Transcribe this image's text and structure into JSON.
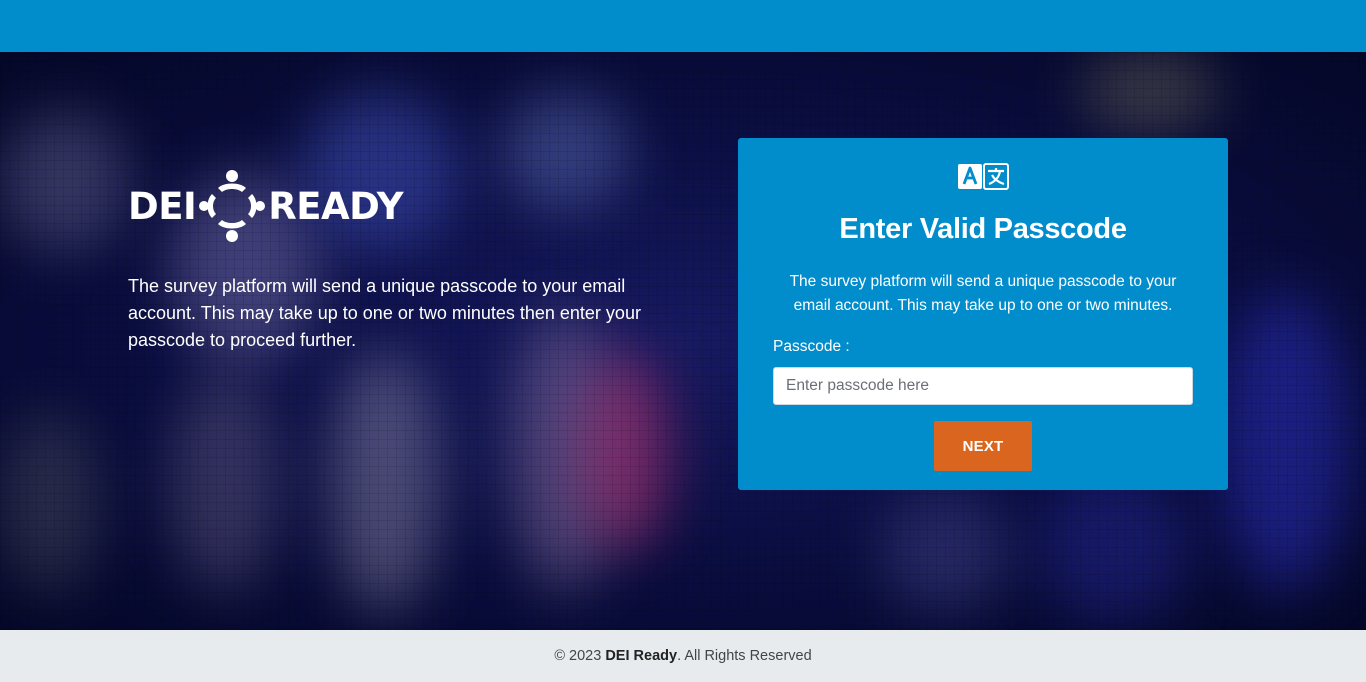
{
  "brand": {
    "word_left": "DEI",
    "word_right": "READY"
  },
  "intro": {
    "text": "The survey platform will send a unique passcode to your email account. This may take up to one or two minutes then enter your passcode to proceed further."
  },
  "card": {
    "icon": "translate-icon",
    "title": "Enter Valid Passcode",
    "description": "The survey platform will send a unique passcode to your email account. This may take up to one or two minutes.",
    "field_label": "Passcode :",
    "input_value": "",
    "input_placeholder": "Enter passcode here",
    "next_label": "NEXT"
  },
  "footer": {
    "copyright": "© 2023",
    "company": "DEI Ready",
    "rights": ". All Rights Reserved"
  },
  "colors": {
    "primary_blue": "#018ccb",
    "next_orange": "#d9651f",
    "footer_bg": "#e8ebee"
  }
}
